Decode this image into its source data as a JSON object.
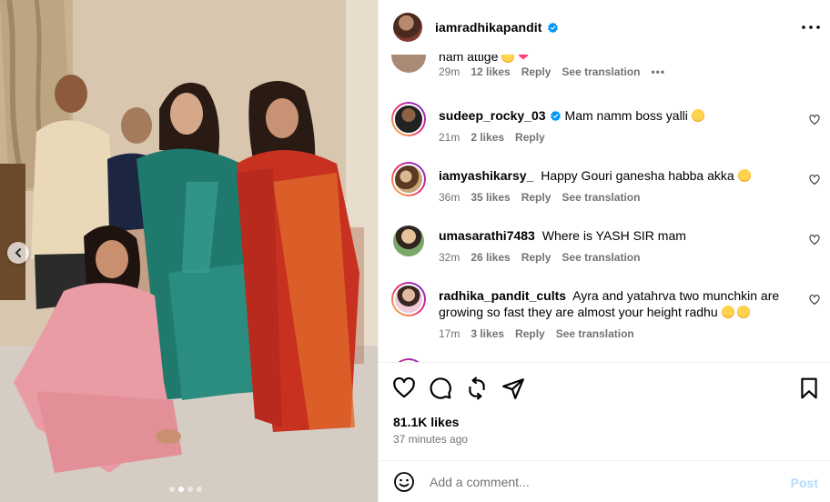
{
  "post": {
    "username": "iamradhikapandit",
    "verified": true,
    "more_icon": "more-horizontal-icon"
  },
  "comments": [
    {
      "user": "",
      "text": "nam attige",
      "time": "29m",
      "likes": "12 likes",
      "reply": "Reply",
      "translation": "See translation",
      "partial": true
    },
    {
      "user": "sudeep_rocky_03",
      "verified": true,
      "text": "Mam namm boss yalli",
      "time": "21m",
      "likes": "2 likes",
      "reply": "Reply"
    },
    {
      "user": "iamyashikarsy_",
      "text": "Happy Gouri ganesha habba akka",
      "time": "36m",
      "likes": "35 likes",
      "reply": "Reply",
      "translation": "See translation"
    },
    {
      "user": "umasarathi7483",
      "text": "Where is YASH SIR mam",
      "time": "32m",
      "likes": "26 likes",
      "reply": "Reply",
      "translation": "See translation"
    },
    {
      "user": "radhika_pandit_cults",
      "text": "Ayra and yatahrva two munchkin are growing so fast they are almost your height radhu",
      "time": "17m",
      "likes": "3 likes",
      "reply": "Reply",
      "translation": "See translation"
    }
  ],
  "actions": {
    "like_icon": "heart-icon",
    "comment_icon": "comment-icon",
    "repost_icon": "repost-icon",
    "share_icon": "share-icon",
    "save_icon": "bookmark-icon"
  },
  "likes": "81.1K likes",
  "time_ago": "37 minutes ago",
  "add_comment": {
    "placeholder": "Add a comment...",
    "post_label": "Post"
  },
  "carousel": {
    "total": 4,
    "active_index": 1
  },
  "colors": {
    "muted": "#737373",
    "verified": "#0095f6",
    "post_disabled": "#b3dbff",
    "story_ring": "#ee2a7b"
  }
}
